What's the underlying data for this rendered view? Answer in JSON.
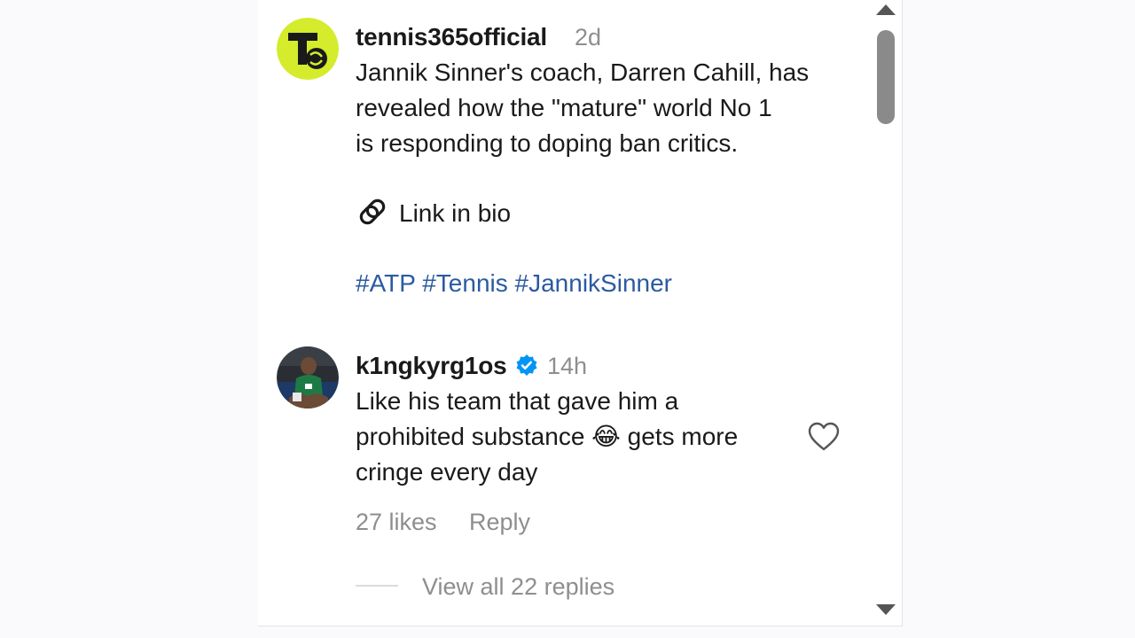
{
  "post": {
    "username": "tennis365official",
    "timestamp": "2d",
    "caption_lines": [
      "Jannik Sinner's coach, Darren Cahill, has",
      "revealed how the \"mature\" world No 1",
      "is responding to doping ban critics."
    ],
    "link_text": "Link in bio",
    "hashtags": [
      "#ATP",
      "#Tennis",
      "#JannikSinner"
    ]
  },
  "comment": {
    "username": "k1ngkyrg1os",
    "verified": true,
    "timestamp": "14h",
    "text_lines": [
      "Like his team that gave him a",
      "prohibited substance 😂 gets more",
      "cringe every day"
    ],
    "likes": "27 likes",
    "reply_label": "Reply",
    "view_replies": "View all 22 replies"
  },
  "colors": {
    "brand_lime": "#d4ec2b",
    "hashtag_blue": "#2b5aa0",
    "verified_blue": "#0095f6",
    "muted_gray": "#8e8e8e"
  },
  "icons": {
    "link": "link-icon",
    "verified": "verified-badge-icon",
    "like": "heart-icon"
  }
}
